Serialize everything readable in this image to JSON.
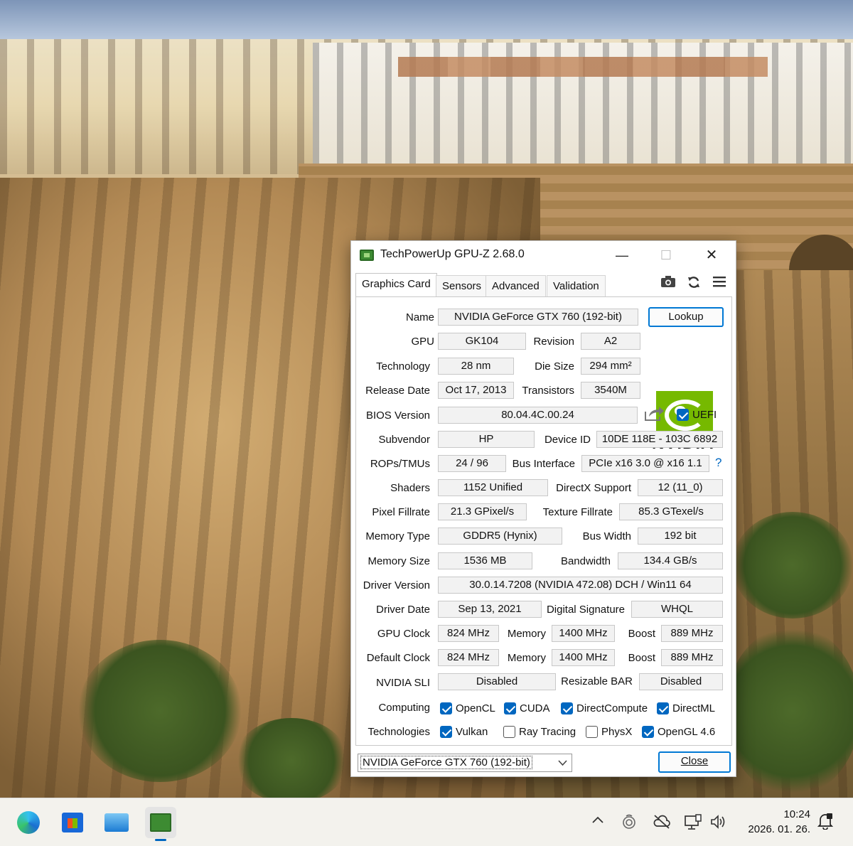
{
  "window": {
    "title": "TechPowerUp GPU-Z 2.68.0",
    "minimize": "—",
    "maximize": "☐",
    "close": "✕"
  },
  "tabs": [
    "Graphics Card",
    "Sensors",
    "Advanced",
    "Validation"
  ],
  "toolbar": {
    "camera_icon": "camera-icon",
    "refresh_icon": "refresh-icon",
    "menu_icon": "menu-icon"
  },
  "fields": {
    "name": {
      "label": "Name",
      "value": "NVIDIA GeForce GTX 760 (192-bit)"
    },
    "lookup": "Lookup",
    "gpu": {
      "label": "GPU",
      "value": "GK104"
    },
    "revision": {
      "label": "Revision",
      "value": "A2"
    },
    "technology": {
      "label": "Technology",
      "value": "28 nm"
    },
    "die_size": {
      "label": "Die Size",
      "value": "294 mm²"
    },
    "release_date": {
      "label": "Release Date",
      "value": "Oct 17, 2013"
    },
    "transistors": {
      "label": "Transistors",
      "value": "3540M"
    },
    "bios_version": {
      "label": "BIOS Version",
      "value": "80.04.4C.00.24"
    },
    "uefi": "UEFI",
    "subvendor": {
      "label": "Subvendor",
      "value": "HP"
    },
    "device_id": {
      "label": "Device ID",
      "value": "10DE 118E - 103C 6892"
    },
    "rops_tmus": {
      "label": "ROPs/TMUs",
      "value": "24 / 96"
    },
    "bus_interface": {
      "label": "Bus Interface",
      "value": "PCIe x16 3.0 @ x16 1.1"
    },
    "help": "?",
    "shaders": {
      "label": "Shaders",
      "value": "1152 Unified"
    },
    "directx": {
      "label": "DirectX Support",
      "value": "12 (11_0)"
    },
    "pixel_fillrate": {
      "label": "Pixel Fillrate",
      "value": "21.3 GPixel/s"
    },
    "texture_fillrate": {
      "label": "Texture Fillrate",
      "value": "85.3 GTexel/s"
    },
    "memory_type": {
      "label": "Memory Type",
      "value": "GDDR5 (Hynix)"
    },
    "bus_width": {
      "label": "Bus Width",
      "value": "192 bit"
    },
    "memory_size": {
      "label": "Memory Size",
      "value": "1536 MB"
    },
    "bandwidth": {
      "label": "Bandwidth",
      "value": "134.4 GB/s"
    },
    "driver_version": {
      "label": "Driver Version",
      "value": "30.0.14.7208 (NVIDIA 472.08) DCH / Win11 64"
    },
    "driver_date": {
      "label": "Driver Date",
      "value": "Sep 13, 2021"
    },
    "digital_signature": {
      "label": "Digital Signature",
      "value": "WHQL"
    },
    "gpu_clock": {
      "label": "GPU Clock",
      "value": "824 MHz",
      "mem_label": "Memory",
      "mem_value": "1400 MHz",
      "boost_label": "Boost",
      "boost_value": "889 MHz"
    },
    "default_clock": {
      "label": "Default Clock",
      "value": "824 MHz",
      "mem_label": "Memory",
      "mem_value": "1400 MHz",
      "boost_label": "Boost",
      "boost_value": "889 MHz"
    },
    "nvidia_sli": {
      "label": "NVIDIA SLI",
      "value": "Disabled"
    },
    "resizable_bar": {
      "label": "Resizable BAR",
      "value": "Disabled"
    },
    "computing_label": "Computing",
    "technologies_label": "Technologies",
    "computing": [
      {
        "name": "OpenCL",
        "checked": true
      },
      {
        "name": "CUDA",
        "checked": true
      },
      {
        "name": "DirectCompute",
        "checked": true
      },
      {
        "name": "DirectML",
        "checked": true
      }
    ],
    "technologies": [
      {
        "name": "Vulkan",
        "checked": true
      },
      {
        "name": "Ray Tracing",
        "checked": false
      },
      {
        "name": "PhysX",
        "checked": false
      },
      {
        "name": "OpenGL 4.6",
        "checked": true
      }
    ]
  },
  "logo": {
    "text": "NVIDIA",
    "color": "#76b900"
  },
  "footer": {
    "gpu_select": "NVIDIA GeForce GTX 760 (192-bit)",
    "close": "Close"
  },
  "taskbar": {
    "apps": [
      "edge-icon",
      "store-icon",
      "photos-icon",
      "gpuz-icon"
    ],
    "tray": {
      "chevron": "^",
      "time": "10:24",
      "date": "2026. 01. 26."
    }
  },
  "colors": {
    "accent": "#0067c0",
    "nvidia_green": "#76b900"
  }
}
